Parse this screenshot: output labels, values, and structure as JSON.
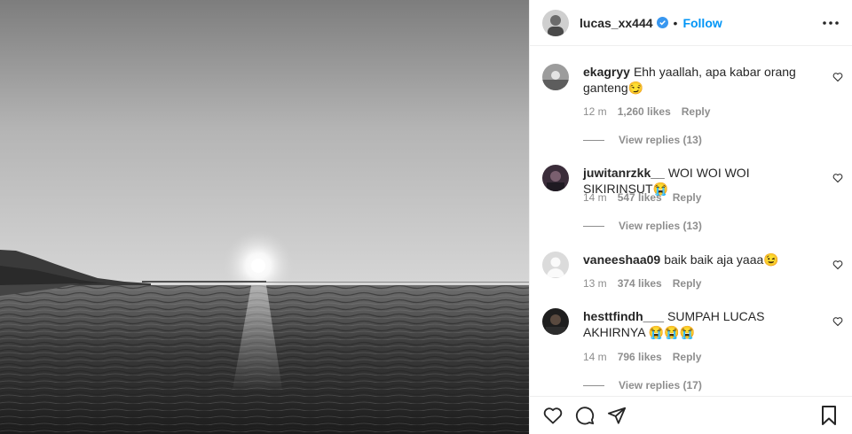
{
  "post": {
    "image_alt": "black and white photo of sunset over the sea",
    "username": "lucas_xx444",
    "verified": true,
    "separator": "•",
    "follow_label": "Follow",
    "more_icon": "more-horizontal-icon"
  },
  "comments": [
    {
      "username": "ekagryy",
      "text": "Ehh yaallah, apa kabar orang ganteng😏",
      "time": "12 m",
      "likes": "1,260 likes",
      "reply_label": "Reply",
      "view_replies": "View replies (13)"
    },
    {
      "username": "juwitanrzkk__",
      "text": "WOI WOI WOI SIKIRINSUT😭",
      "time": "14 m",
      "likes": "547 likes",
      "reply_label": "Reply",
      "view_replies": "View replies (13)"
    },
    {
      "username": "vaneeshaa09",
      "text": "baik baik aja yaaa😉",
      "time": "13 m",
      "likes": "374 likes",
      "reply_label": "Reply",
      "view_replies": ""
    },
    {
      "username": "hesttfindh___",
      "text": "SUMPAH LUCAS AKHIRNYA 😭😭😭",
      "time": "14 m",
      "likes": "796 likes",
      "reply_label": "Reply",
      "view_replies": "View replies (17)"
    }
  ],
  "actions": {
    "like_icon": "heart-icon",
    "comment_icon": "comment-icon",
    "share_icon": "share-icon",
    "save_icon": "bookmark-icon"
  },
  "colors": {
    "link_blue": "#0095f6",
    "verified_blue": "#3897f0",
    "muted_text": "#8e8e8e",
    "border": "#efefef"
  }
}
